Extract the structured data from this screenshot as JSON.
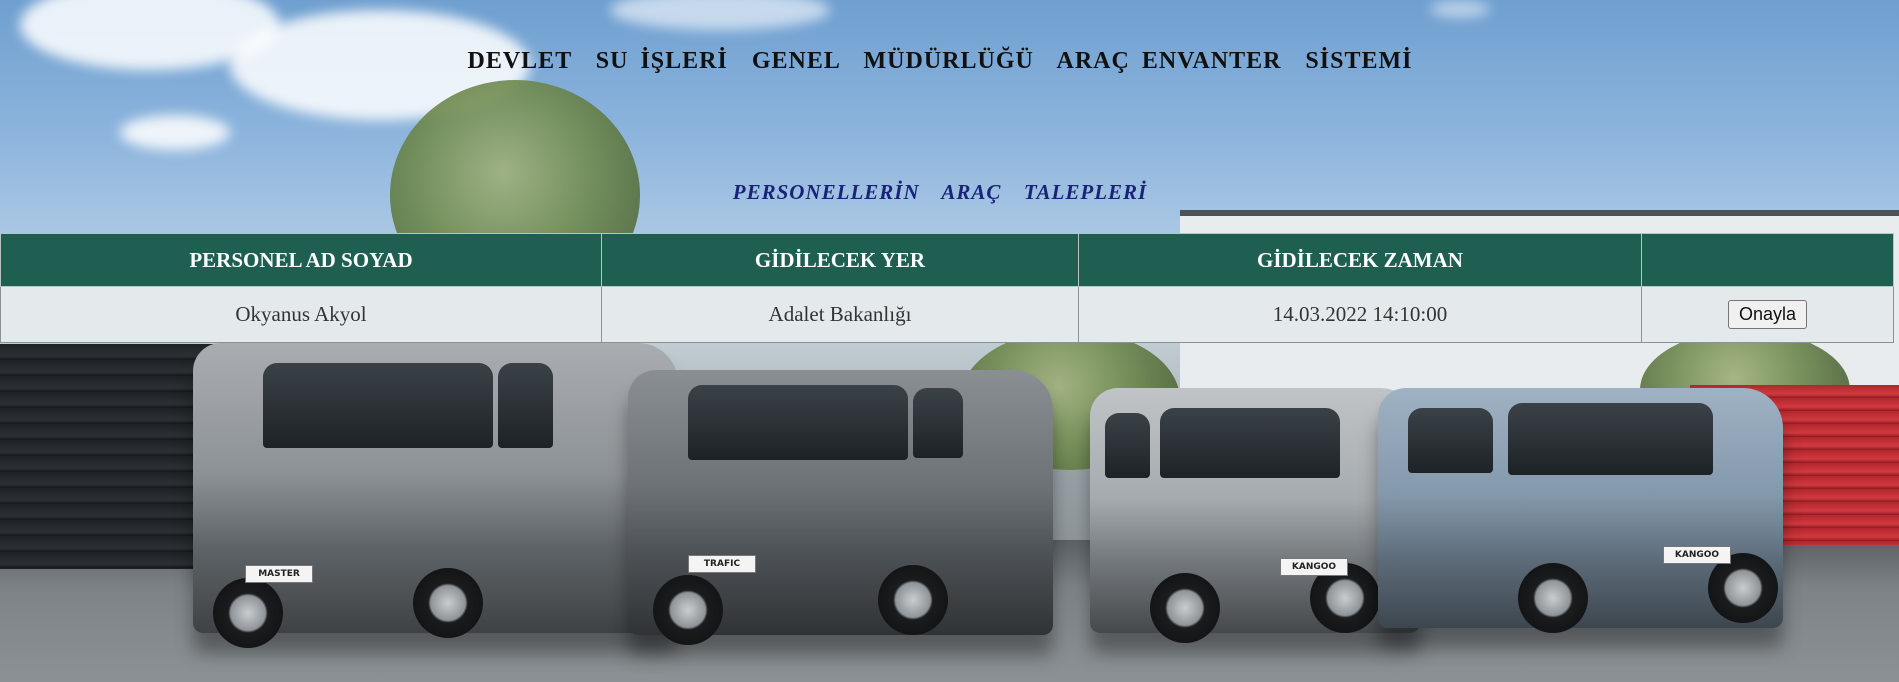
{
  "header": {
    "title": "DEVLET  SU İŞLERİ  GENEL  MÜDÜRLÜĞÜ  ARAÇ ENVANTER  SİSTEMİ",
    "subtitle": "PERSONELLERİN  ARAÇ  TALEPLERİ"
  },
  "table": {
    "columns": [
      "PERSONEL AD SOYAD",
      "GİDİLECEK YER",
      "GİDİLECEK ZAMAN",
      ""
    ],
    "rows": [
      {
        "name": "Okyanus Akyol",
        "destination": "Adalet Bakanlığı",
        "time": "14.03.2022 14:10:00",
        "action_label": "Onayla"
      }
    ]
  },
  "background": {
    "plates": [
      "MASTER",
      "TRAFIC",
      "KANGOO",
      "KANGOO"
    ]
  },
  "colors": {
    "header_bg": "#1e5f52",
    "row_bg": "#e4eaec",
    "subtitle": "#1a2378"
  }
}
